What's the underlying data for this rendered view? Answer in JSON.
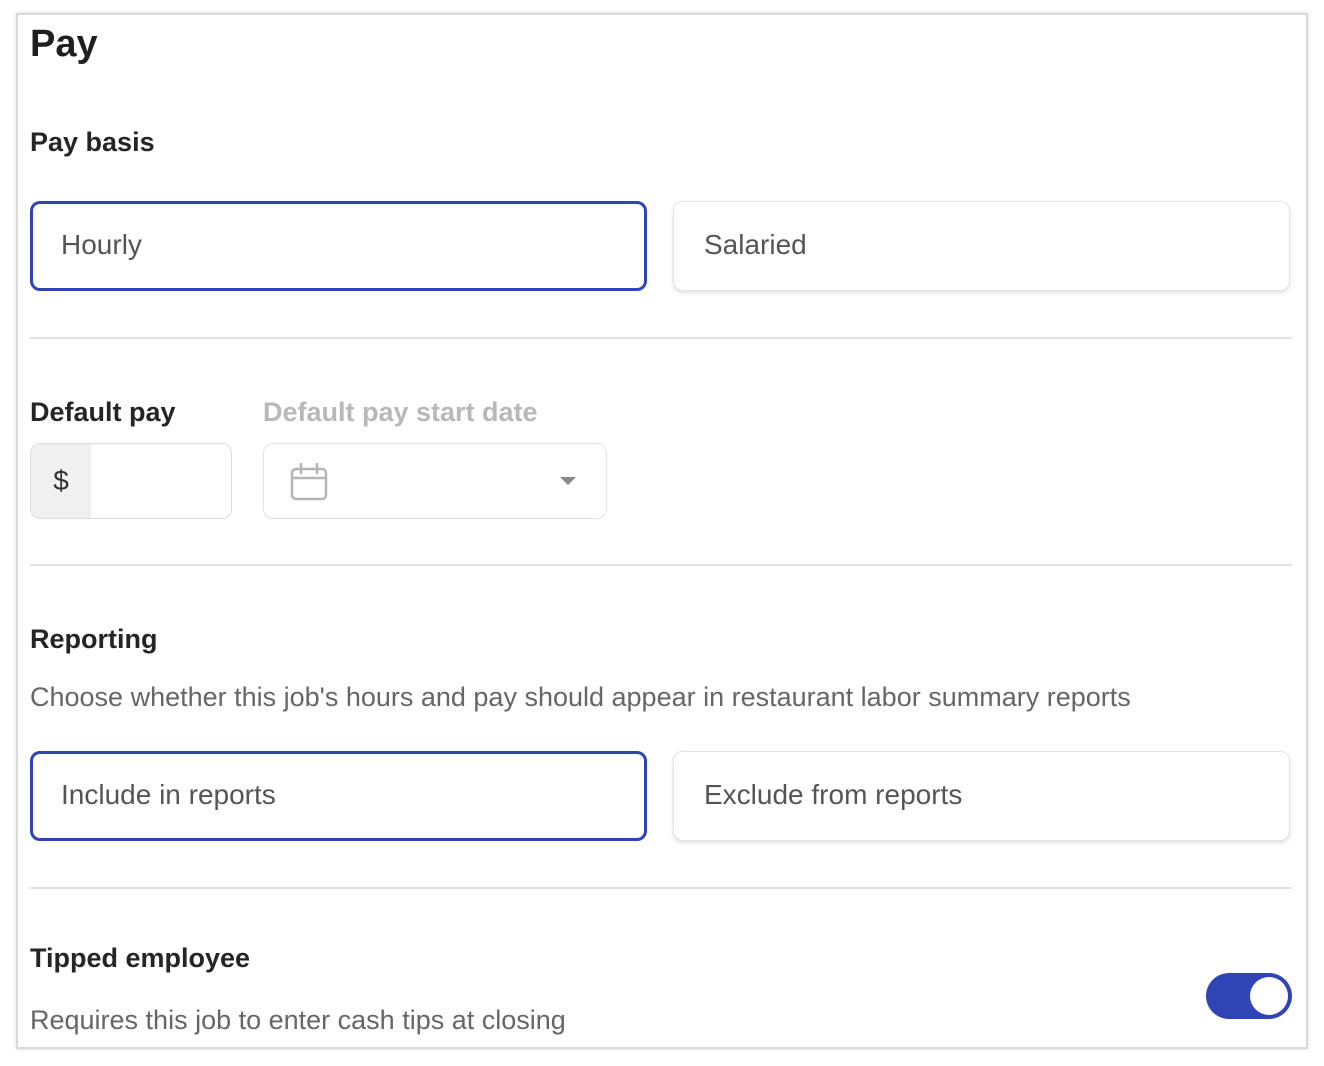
{
  "section": {
    "title": "Pay"
  },
  "pay_basis": {
    "heading": "Pay basis",
    "options": [
      {
        "label": "Hourly",
        "selected": true
      },
      {
        "label": "Salaried",
        "selected": false
      }
    ]
  },
  "default_pay": {
    "heading": "Default pay",
    "currency_symbol": "$",
    "value": "",
    "start_date_heading": "Default pay start date",
    "start_date_value": ""
  },
  "reporting": {
    "heading": "Reporting",
    "description": "Choose whether this job's hours and pay should appear in restaurant labor summary reports",
    "options": [
      {
        "label": "Include in reports",
        "selected": true
      },
      {
        "label": "Exclude from reports",
        "selected": false
      }
    ]
  },
  "tipped": {
    "heading": "Tipped employee",
    "description": "Requires this job to enter cash tips at closing",
    "enabled": true
  },
  "colors": {
    "accent": "#2f45b5",
    "muted_text": "#666666",
    "disabled_text": "#b8b8b8"
  },
  "icons": {
    "date_picker": "calendar-icon",
    "dropdown": "caret-down-icon"
  }
}
